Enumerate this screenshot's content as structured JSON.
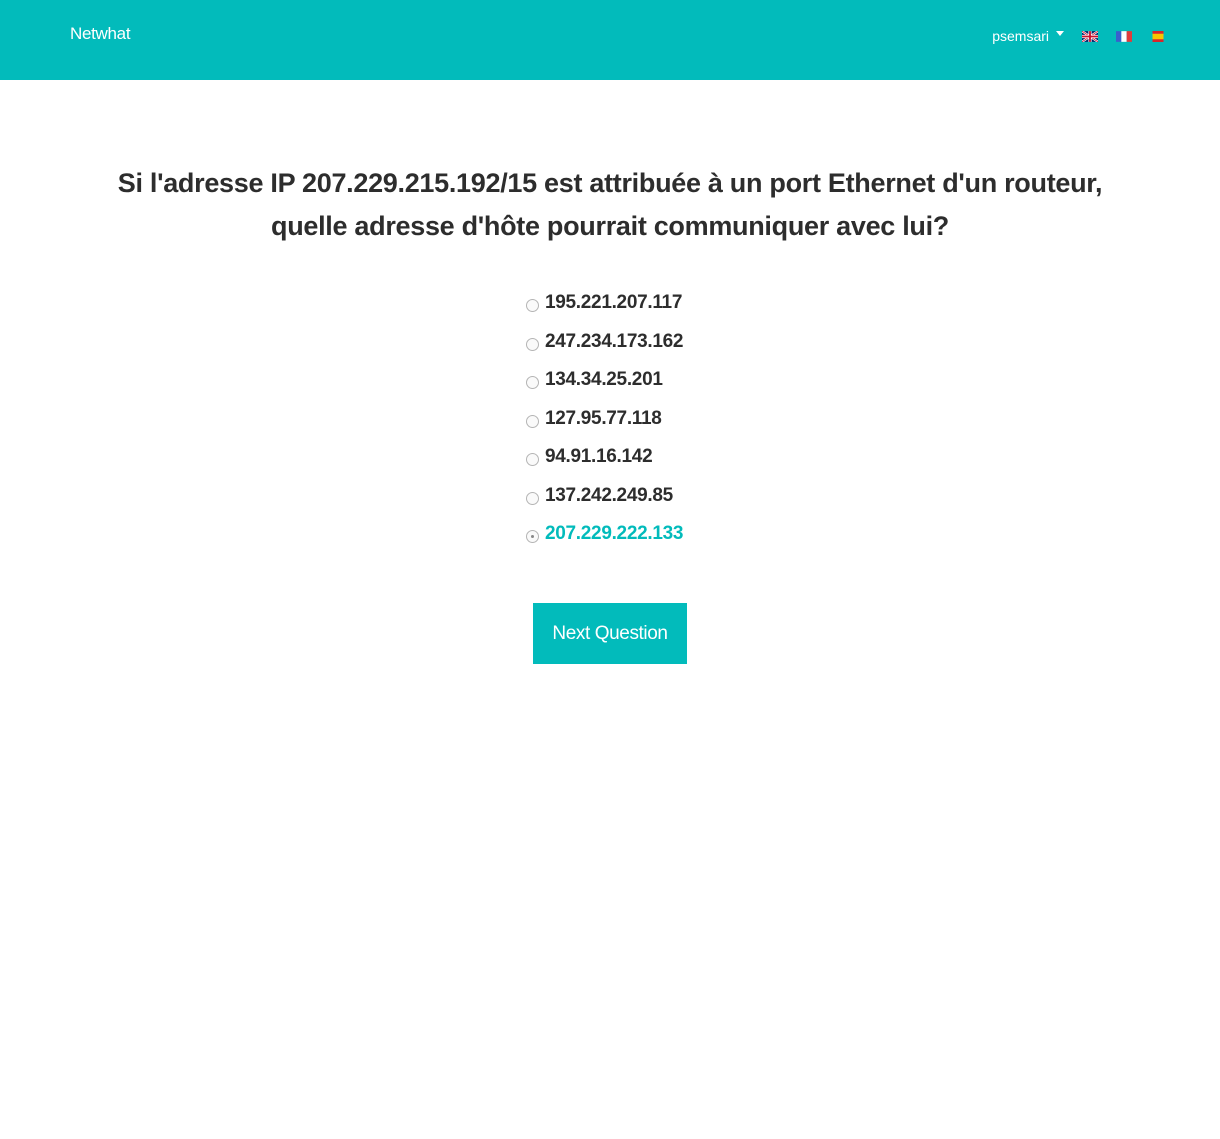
{
  "navbar": {
    "brand": "Netwhat",
    "user": "psemsari",
    "flags": [
      "english-flag-icon",
      "french-flag-icon",
      "spanish-flag-icon"
    ]
  },
  "colors": {
    "accent": "#02bbbb",
    "text": "#2d2d2d"
  },
  "quiz": {
    "question": "Si l'adresse IP 207.229.215.192/15 est attribuée à un port Ethernet d'un routeur, quelle adresse d'hôte pourrait communiquer avec lui?",
    "options": [
      "195.221.207.117",
      "247.234.173.162",
      "134.34.25.201",
      "127.95.77.118",
      "94.91.16.142",
      "137.242.249.85",
      "207.229.222.133"
    ],
    "selected_index": 6,
    "next_label": "Next Question"
  }
}
